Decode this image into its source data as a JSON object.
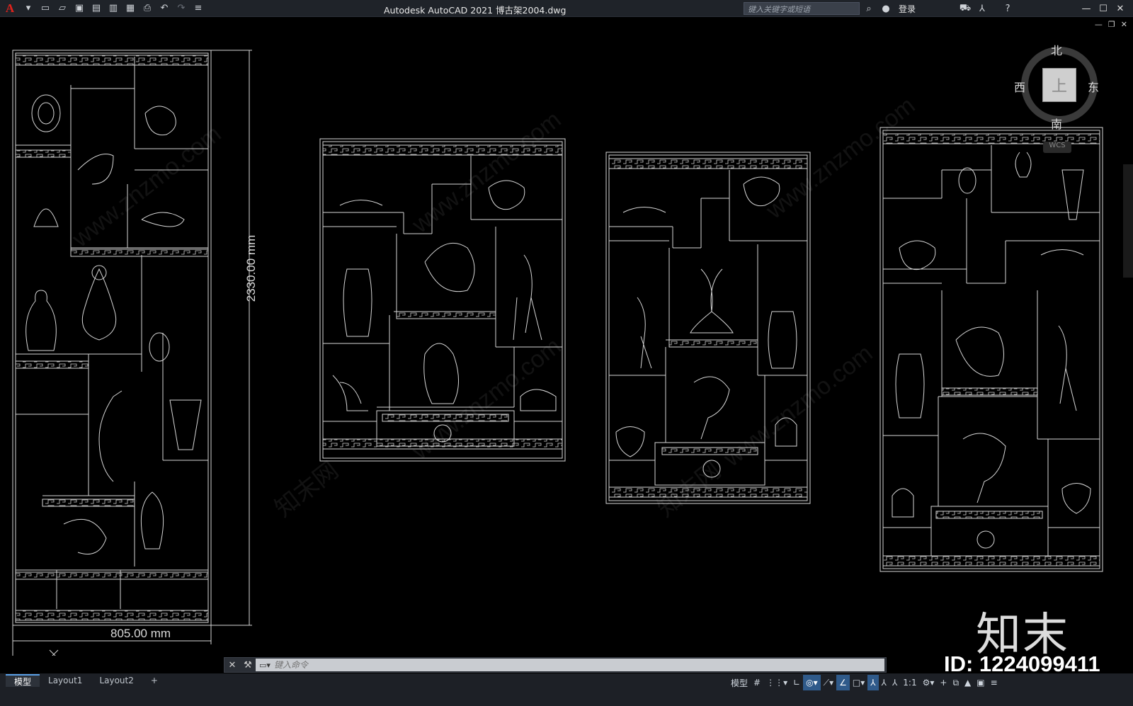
{
  "app": {
    "logo": "A",
    "title": "Autodesk AutoCAD 2021    博古架2004.dwg",
    "search_placeholder": "键入关键字或短语",
    "login": "登录"
  },
  "quick_access": {
    "icons": [
      "new-icon",
      "open-icon",
      "save-icon",
      "saveas-icon",
      "plot-preview-icon",
      "publish-icon",
      "print-icon",
      "undo-icon",
      "redo-icon",
      "customize-icon"
    ]
  },
  "window_controls": {
    "minimize": "—",
    "maximize": "☐",
    "close": "✕"
  },
  "doc_controls": {
    "minimize": "—",
    "restore": "❐",
    "close": "✕"
  },
  "viewcube": {
    "north": "北",
    "south": "南",
    "west": "西",
    "east": "东",
    "face": "上",
    "wcs": "WCS"
  },
  "drawing": {
    "height_dim": "2330.00 mm",
    "width_dim": "805.00 mm"
  },
  "watermarks": {
    "text1": "www.znzmo.com",
    "text2": "知末网"
  },
  "brand": {
    "logo": "知末",
    "id": "ID: 1224099411"
  },
  "command_line": {
    "placeholder": "键入命令",
    "close": "✕",
    "wrench": "🔧"
  },
  "layout_tabs": [
    {
      "label": "模型",
      "active": true
    },
    {
      "label": "Layout1",
      "active": false
    },
    {
      "label": "Layout2",
      "active": false
    },
    {
      "label": "+",
      "active": false
    }
  ],
  "status": {
    "model": "模型",
    "scale": "1:1"
  },
  "colors": {
    "background": "#000000",
    "linework": "#d8d8d8",
    "accent": "#5aa0e6",
    "logo_red": "#e3231c"
  }
}
